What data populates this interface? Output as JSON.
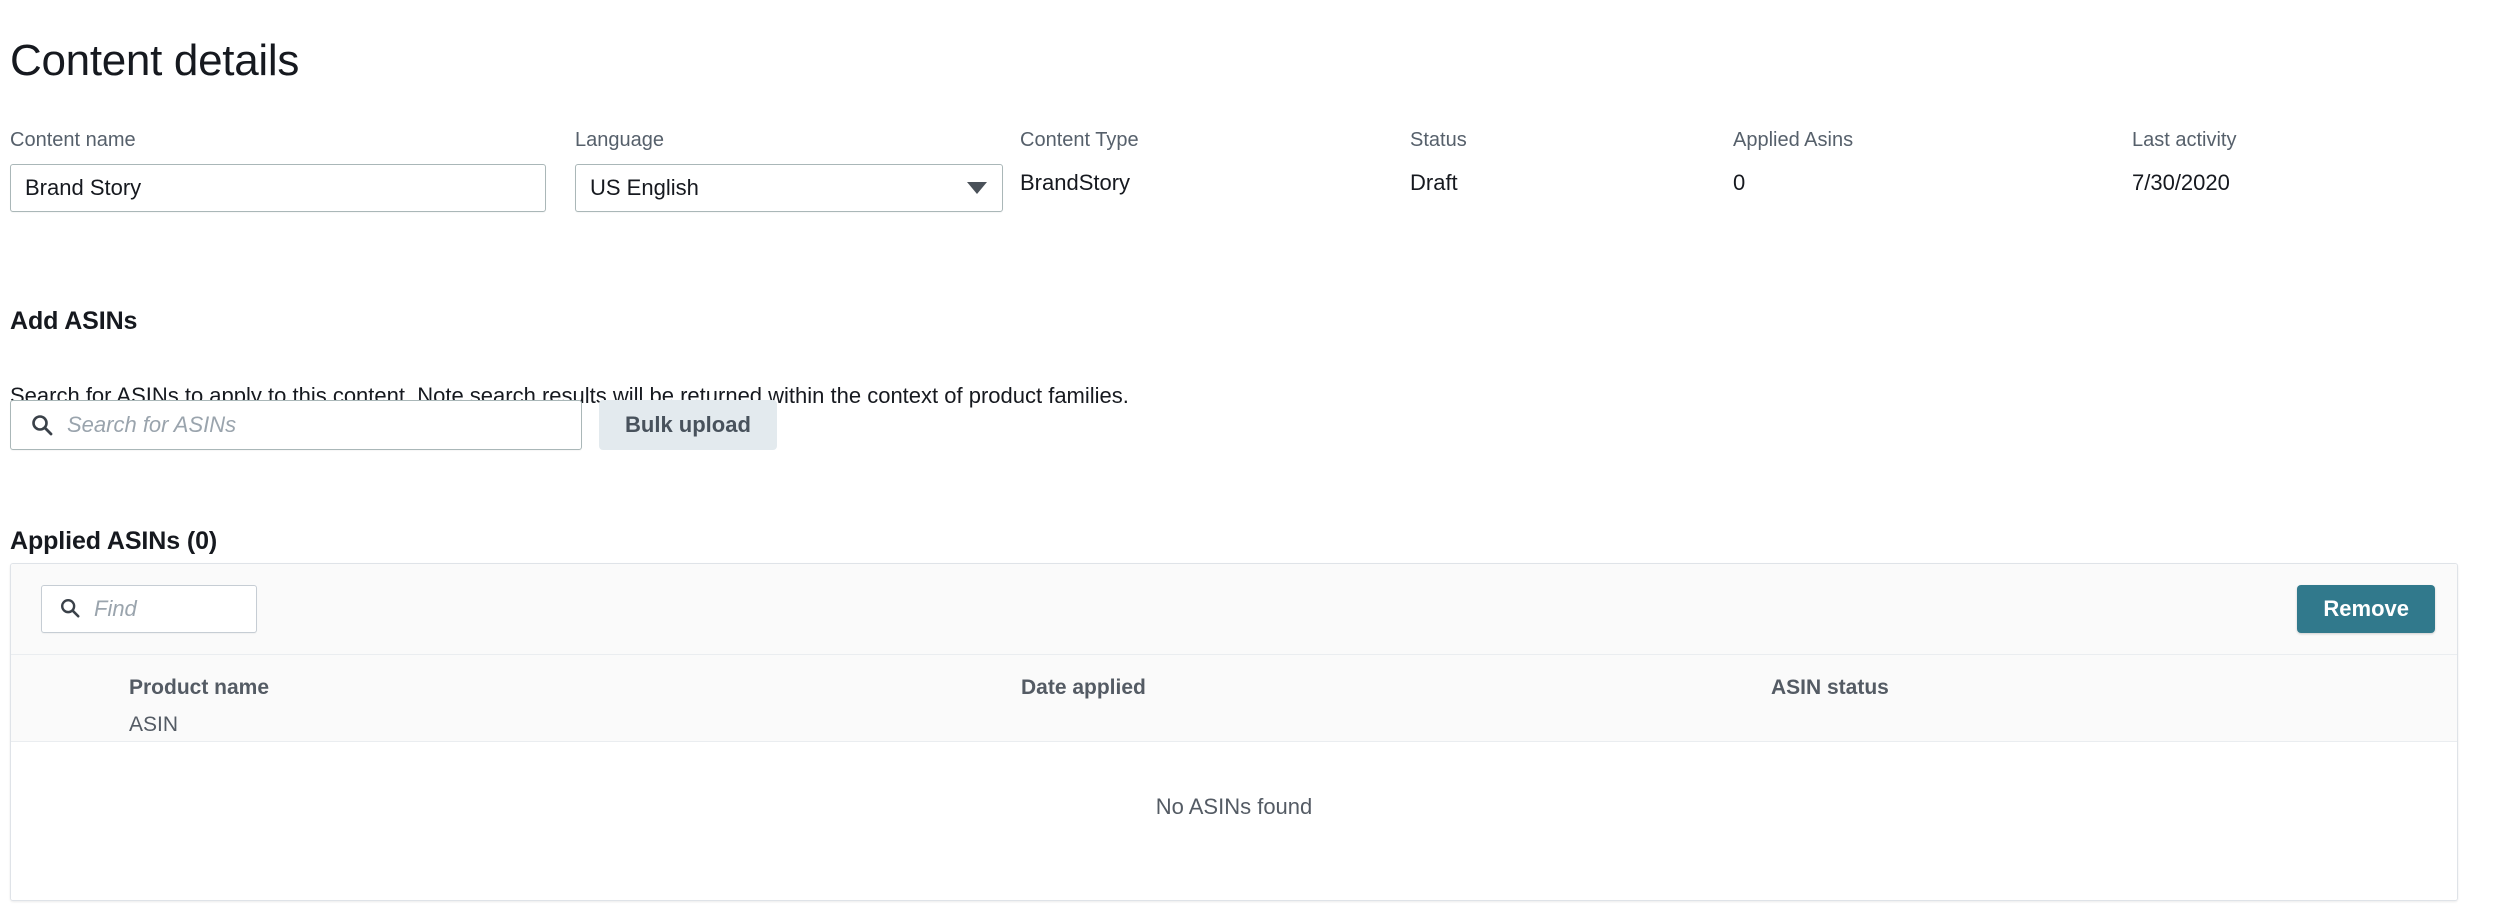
{
  "page": {
    "title": "Content details"
  },
  "summary": {
    "fields": [
      {
        "label": "Content name",
        "value": "Brand Story",
        "type": "input"
      },
      {
        "label": "Language",
        "value": "US English",
        "type": "select"
      },
      {
        "label": "Content Type",
        "value": "BrandStory",
        "type": "text"
      },
      {
        "label": "Status",
        "value": "Draft",
        "type": "text"
      },
      {
        "label": "Applied Asins",
        "value": "0",
        "type": "text"
      },
      {
        "label": "Last activity",
        "value": "7/30/2020",
        "type": "text"
      }
    ]
  },
  "add_asins": {
    "heading": "Add ASINs",
    "description": "Search for ASINs to apply to this content. Note search results will be returned within the context of product families.",
    "search_placeholder": "Search for ASINs",
    "search_value": "",
    "search_icon": "search-icon",
    "bulk_upload_label": "Bulk upload"
  },
  "applied_asins": {
    "heading": "Applied ASINs (0)",
    "count": 0,
    "toolbar": {
      "find_placeholder": "Find",
      "find_value": "",
      "find_icon": "search-icon",
      "remove_label": "Remove"
    },
    "columns": [
      {
        "header": "Product name",
        "subheader": "ASIN"
      },
      {
        "header": "Date applied",
        "subheader": ""
      },
      {
        "header": "ASIN status",
        "subheader": ""
      }
    ],
    "rows": [],
    "empty_message": "No ASINs found"
  },
  "colors": {
    "primary_button": "#31798c",
    "secondary_button_bg": "#e3eaee",
    "label_text": "#56606b",
    "body_text": "#16191f",
    "card_border": "#dfe3e8",
    "toolbar_bg": "#fafafa"
  }
}
